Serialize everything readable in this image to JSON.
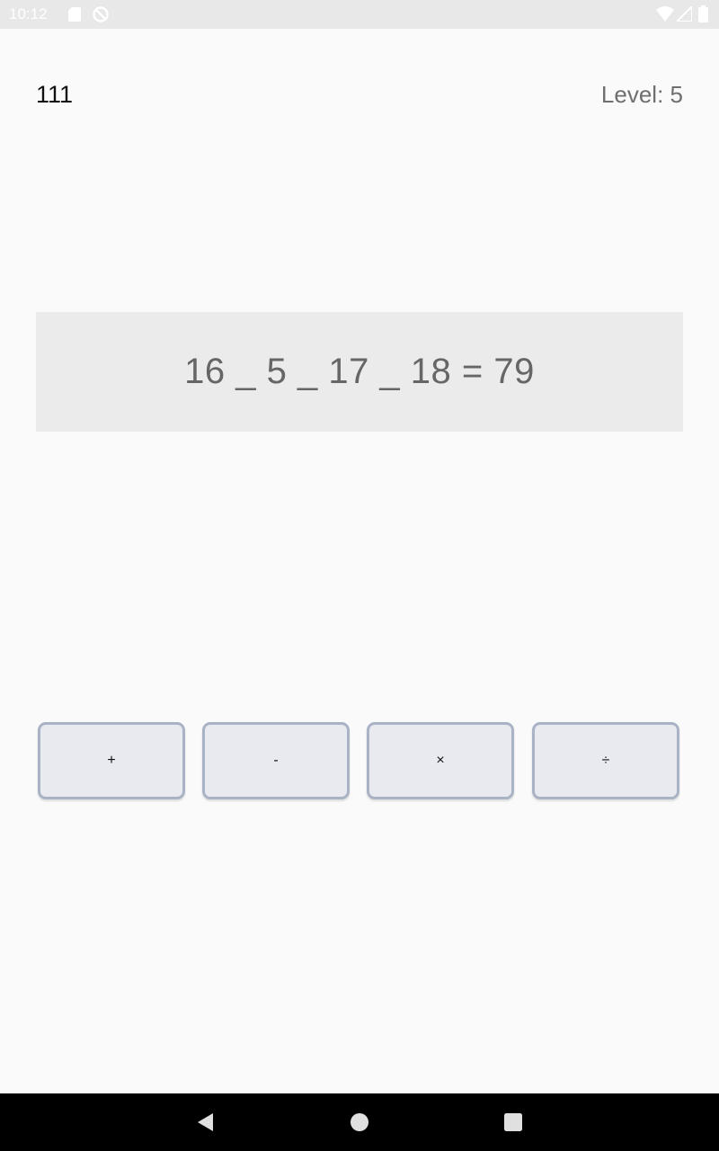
{
  "status_bar": {
    "time": "10:12",
    "icons": [
      "sd-card-icon",
      "sync-blocked-icon",
      "wifi-icon",
      "signal-icon",
      "battery-icon"
    ]
  },
  "game": {
    "score": "111",
    "level": "Level: 5",
    "equation": "16 _ 5 _ 17 _ 18 = 79"
  },
  "operators": [
    {
      "label": "+"
    },
    {
      "label": "-"
    },
    {
      "label": "×"
    },
    {
      "label": "÷"
    }
  ],
  "nav_bar": {
    "buttons": [
      "back-icon",
      "home-icon",
      "recents-icon"
    ]
  },
  "colors": {
    "background": "#fafafa",
    "status_bar": "#e8e8e8",
    "equation_panel": "#ebebeb",
    "button_fill": "#e8eaf0",
    "button_border": "#aab3c5",
    "nav_bar": "#000000"
  }
}
